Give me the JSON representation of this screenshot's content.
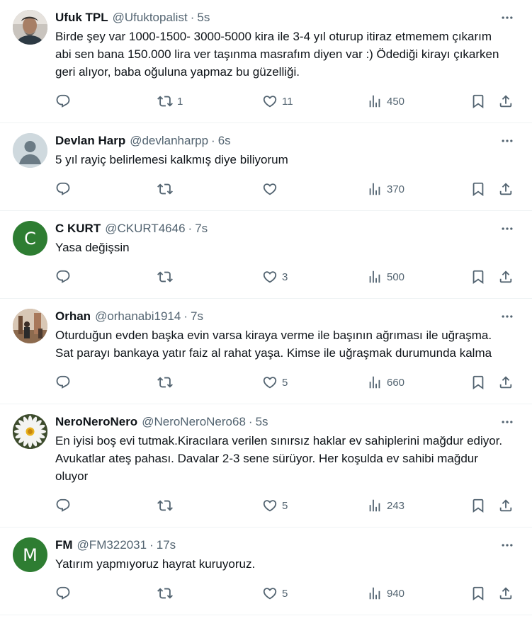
{
  "tweets": [
    {
      "name": "Ufuk TPL",
      "handle": "@Ufuktopalist",
      "time": "5s",
      "text": "Birde şey var 1000-1500- 3000-5000 kira ile 3-4 yıl oturup itiraz etmemem çıkarım abi sen bana 150.000 lira ver taşınma masrafım diyen var :) Ödediği kirayı çıkarken geri alıyor, baba oğuluna yapmaz bu güzelliği.",
      "replies": "",
      "retweets": "1",
      "likes": "11",
      "views": "450",
      "avatar": {
        "type": "photo",
        "bg": "#8a8580"
      }
    },
    {
      "name": "Devlan Harp",
      "handle": "@devlanharpp",
      "time": "6s",
      "text": "5 yıl rayiç belirlemesi kalkmış diye biliyorum",
      "replies": "",
      "retweets": "",
      "likes": "",
      "views": "370",
      "avatar": {
        "type": "default",
        "bg": "#cfd9de"
      }
    },
    {
      "name": "C KURT",
      "handle": "@CKURT4646",
      "time": "7s",
      "text": "Yasa değişsin",
      "replies": "",
      "retweets": "",
      "likes": "3",
      "views": "500",
      "avatar": {
        "type": "letter",
        "letter": "C",
        "bg": "#2e7d32"
      }
    },
    {
      "name": "Orhan",
      "handle": "@orhanabi1914",
      "time": "7s",
      "text": "Oturduğun evden başka evin varsa kiraya  verme ile başının ağrıması ile uğraşma. Sat parayı bankaya yatır faiz al rahat yaşa. Kimse ile uğraşmak durumunda kalma",
      "replies": "",
      "retweets": "",
      "likes": "5",
      "views": "660",
      "avatar": {
        "type": "photo2",
        "bg": "#b08a6e"
      }
    },
    {
      "name": "NeroNeroNero",
      "handle": "@NeroNeroNero68",
      "time": "5s",
      "text": "En iyisi boş evi tutmak.Kiracılara verilen sınırsız haklar ev sahiplerini mağdur ediyor. Avukatlar ateş pahası. Davalar 2-3 sene sürüyor. Her koşulda ev sahibi mağdur oluyor",
      "replies": "",
      "retweets": "",
      "likes": "5",
      "views": "243",
      "avatar": {
        "type": "flower",
        "bg": "#3a4a2a"
      }
    },
    {
      "name": "FM",
      "handle": "@FM322031",
      "time": "17s",
      "text": "Yatırım yapmıyoruz hayrat kuruyoruz.",
      "replies": "",
      "retweets": "",
      "likes": "5",
      "views": "940",
      "avatar": {
        "type": "letter",
        "letter": "M",
        "bg": "#2e7d32"
      }
    }
  ],
  "separator": "·",
  "icons": {
    "reply": "reply-icon",
    "retweet": "retweet-icon",
    "like": "heart-icon",
    "views": "views-icon",
    "bookmark": "bookmark-icon",
    "share": "share-icon",
    "more": "more-icon"
  },
  "colors": {
    "text": "#0f1419",
    "secondary": "#536471",
    "border": "#eff3f4"
  }
}
